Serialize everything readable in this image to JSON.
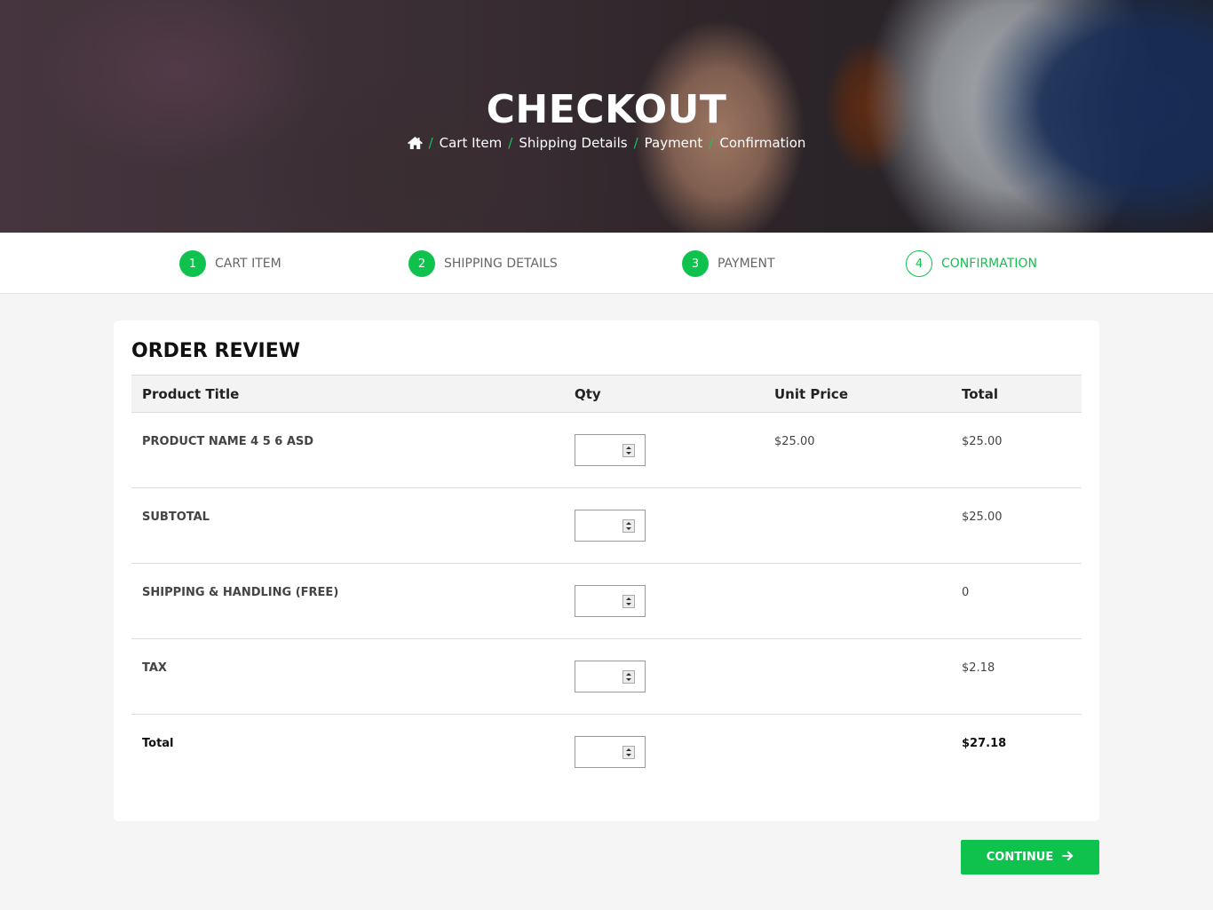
{
  "hero": {
    "title": "CHECKOUT",
    "breadcrumb": [
      "Cart Item",
      "Shipping Details",
      "Payment",
      "Confirmation"
    ],
    "home_icon": "home-icon"
  },
  "steps": [
    {
      "number": "1",
      "label": "CART ITEM",
      "state": "completed"
    },
    {
      "number": "2",
      "label": "SHIPPING DETAILS",
      "state": "completed"
    },
    {
      "number": "3",
      "label": "PAYMENT",
      "state": "completed"
    },
    {
      "number": "4",
      "label": "CONFIRMATION",
      "state": "active"
    }
  ],
  "order": {
    "title": "ORDER REVIEW",
    "headers": [
      "Product Title",
      "Qty",
      "Unit Price",
      "Total"
    ],
    "rows": [
      {
        "title": "PRODUCT NAME 4 5 6 ASD",
        "qty": "",
        "unit_price": "$25.00",
        "total": "$25.00"
      },
      {
        "title": "SUBTOTAL",
        "qty": "",
        "unit_price": "",
        "total": "$25.00"
      },
      {
        "title": "SHIPPING & HANDLING (FREE)",
        "qty": "",
        "unit_price": "",
        "total": "0"
      },
      {
        "title": "TAX",
        "qty": "",
        "unit_price": "",
        "total": "$2.18"
      },
      {
        "title": "Total",
        "qty": "",
        "unit_price": "",
        "total": "$27.18"
      }
    ]
  },
  "actions": {
    "continue_label": "CONTINUE",
    "continue_icon": "arrow-right-icon"
  },
  "colors": {
    "accent": "#0fc24e",
    "page_background": "#f5f5f5"
  }
}
